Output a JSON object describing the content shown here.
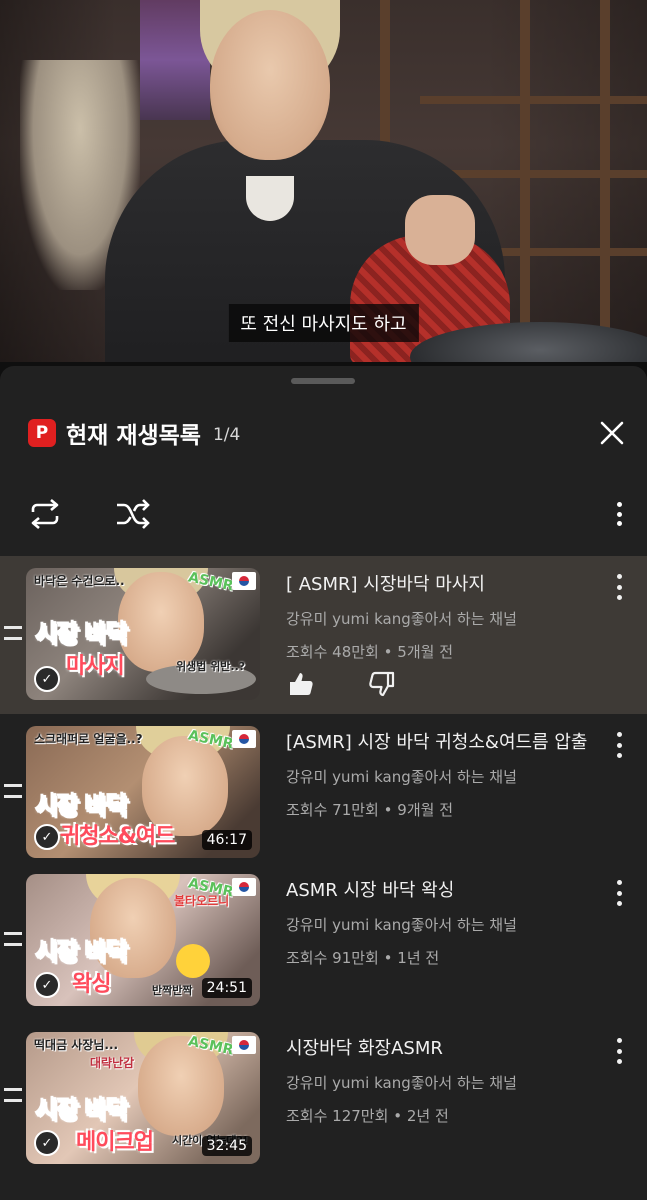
{
  "video": {
    "caption": "또 전신 마사지도 하고"
  },
  "panel": {
    "badge": "P",
    "title": "현재 재생목록",
    "position": "1/4",
    "close_icon": "close-icon",
    "loop_icon": "repeat-icon",
    "shuffle_icon": "shuffle-icon",
    "more_icon": "more-vert-icon"
  },
  "items": [
    {
      "title": "[ ASMR] 시장바닥 마사지",
      "channel": "강유미 yumi kang좋아서 하는 채널",
      "meta_views": "조회수 48만회",
      "meta_age": "5개월 전",
      "thumb_line1": "시장 바닥",
      "thumb_line2": "마사지",
      "thumb_note": "바닥은 수건으로..",
      "thumb_note2": "위생법 위반..?",
      "asmr": "ASMR",
      "duration": "",
      "active": true
    },
    {
      "title": "[ASMR] 시장 바닥 귀청소&여드름 압출",
      "channel": "강유미 yumi kang좋아서 하는 채널",
      "meta_views": "조회수 71만회",
      "meta_age": "9개월 전",
      "thumb_line1": "시장 바닥",
      "thumb_line2": "귀청소&여드",
      "thumb_note": "스크래퍼로 얼굴을..?",
      "asmr": "ASMR",
      "duration": "46:17"
    },
    {
      "title": "ASMR 시장 바닥 왁싱",
      "channel": "강유미 yumi kang좋아서 하는 채널",
      "meta_views": "조회수 91만회",
      "meta_age": "1년 전",
      "thumb_line1": "시장 바닥",
      "thumb_line2": "왁싱",
      "thumb_note": "불타오르니",
      "thumb_note2": "반짝반짝",
      "asmr": "ASMR",
      "duration": "24:51"
    },
    {
      "title": "시장바닥 화장ASMR",
      "channel": "강유미 yumi kang좋아서 하는 채널",
      "meta_views": "조회수 127만회",
      "meta_age": "2년 전",
      "thumb_line1": "시장 바닥",
      "thumb_line2": "메이크업",
      "thumb_note": "떡대금 사장님...",
      "thumb_note2": "대략난감",
      "thumb_note3": "시간이 없는데?!",
      "asmr": "ASMR",
      "duration": "32:45"
    }
  ],
  "separator": "•",
  "colors": {
    "background": "#0f0f0f",
    "sheet": "#212121",
    "active_row": "#3e3a36",
    "badge_red": "#e02020",
    "secondary_text": "#aaaaaa"
  }
}
